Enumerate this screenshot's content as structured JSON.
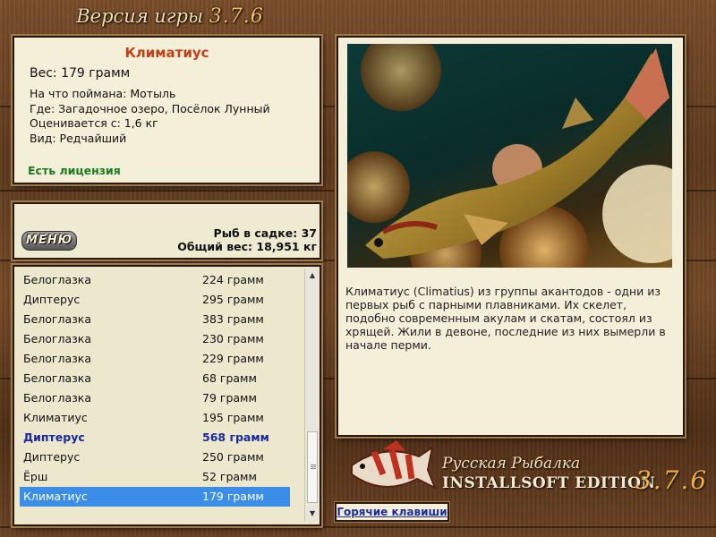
{
  "header": {
    "version_label": "Версия игры",
    "version_number": "3.7.6"
  },
  "catch_info": {
    "fish_name": "Климатиус",
    "weight": "Вес: 179 грамм",
    "lines": [
      "На что поймана: Мотыль",
      "Где: Загадочное озеро, Посёлок Лунный",
      "Оценивается с: 1,6 кг",
      "Вид: Редчайший"
    ],
    "license": "Есть лицензия"
  },
  "menu": {
    "menu_label": "МЕНЮ",
    "fish_count": "Рыб в садке: 37",
    "total_weight": "Общий вес: 18,951 кг"
  },
  "fish_list": [
    {
      "name": "Белоглазка",
      "weight": "224 грамм"
    },
    {
      "name": "Диптерус",
      "weight": "295 грамм"
    },
    {
      "name": "Белоглазка",
      "weight": "383 грамм"
    },
    {
      "name": "Белоглазка",
      "weight": "230 грамм"
    },
    {
      "name": "Белоглазка",
      "weight": "229 грамм"
    },
    {
      "name": "Белоглазка",
      "weight": "68 грамм"
    },
    {
      "name": "Белоглазка",
      "weight": "79 грамм"
    },
    {
      "name": "Климатиус",
      "weight": "195 грамм"
    },
    {
      "name": "Диптерус",
      "weight": "568 грамм"
    },
    {
      "name": "Диптерус",
      "weight": "250 грамм"
    },
    {
      "name": "Ёрш",
      "weight": "52 грамм"
    },
    {
      "name": "Климатиус",
      "weight": "179 грамм"
    }
  ],
  "fish_list_state": {
    "bold_index": 8,
    "selected_index": 11
  },
  "description": "Климатиус (Climatius) из группы акантодов - одни из первых рыб с парными плавниками. Их скелет, подобно современным акулам и скатам, состоял из хрящей. Жили в девоне, последние из них вымерли в начале перми.",
  "logo": {
    "title": "Русская Рыбалка",
    "edition": "INSTALLSOFT EDITION",
    "version": "3.7.6"
  },
  "hotkeys_label": "Горячие клавиши",
  "icons": {
    "scroll_up": "triangle-up-icon",
    "scroll_down": "triangle-down-icon"
  },
  "colors": {
    "fish_title": "#c0401a",
    "license": "#1f7a1f",
    "bold_row": "#1a2a9c",
    "selected_row": "#3a8ee8",
    "panel_bg": "#f3efd9"
  }
}
